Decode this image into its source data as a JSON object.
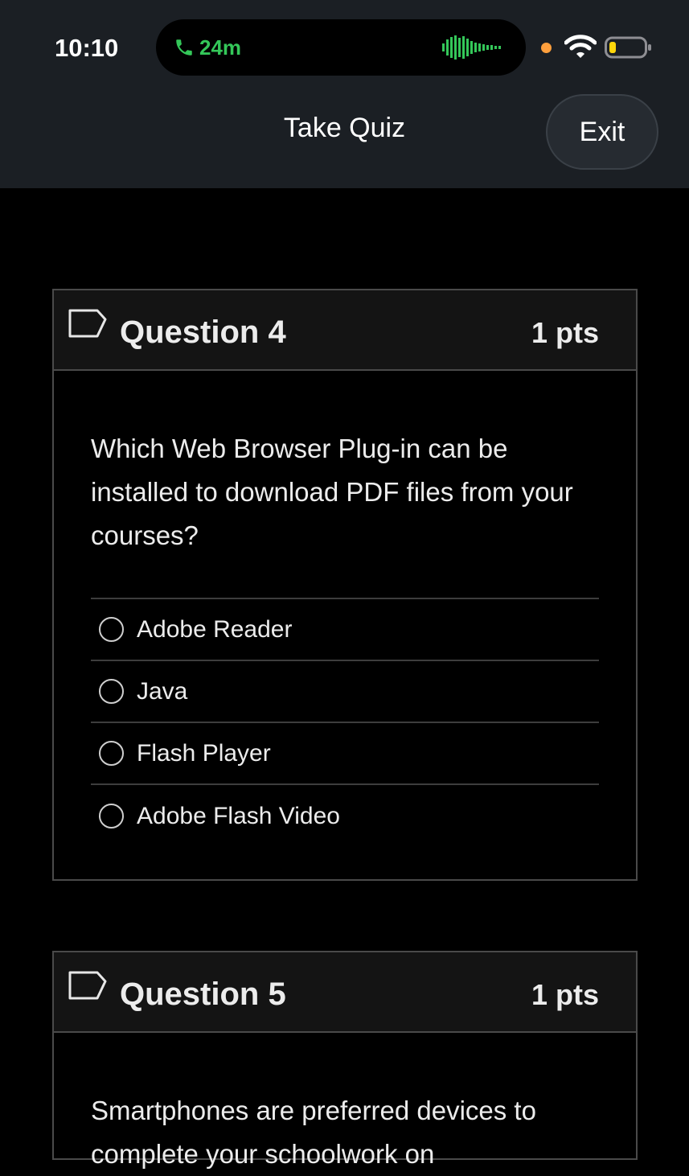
{
  "status_bar": {
    "time": "10:10",
    "call_duration": "24m",
    "colors": {
      "call": "#34c759",
      "recording_dot": "#ff9f3d"
    },
    "icons": [
      "phone-icon",
      "waveform-icon",
      "wifi-icon",
      "battery-icon"
    ]
  },
  "header": {
    "title": "Take Quiz",
    "exit_label": "Exit"
  },
  "questions": [
    {
      "title": "Question 4",
      "points": "1 pts",
      "text": "Which Web Browser Plug-in can be installed to download PDF files from your courses?",
      "answers": [
        "Adobe Reader",
        "Java",
        "Flash Player",
        "Adobe Flash Video"
      ]
    },
    {
      "title": "Question 5",
      "points": "1 pts",
      "text": "Smartphones are preferred devices to complete your schoolwork on"
    }
  ]
}
